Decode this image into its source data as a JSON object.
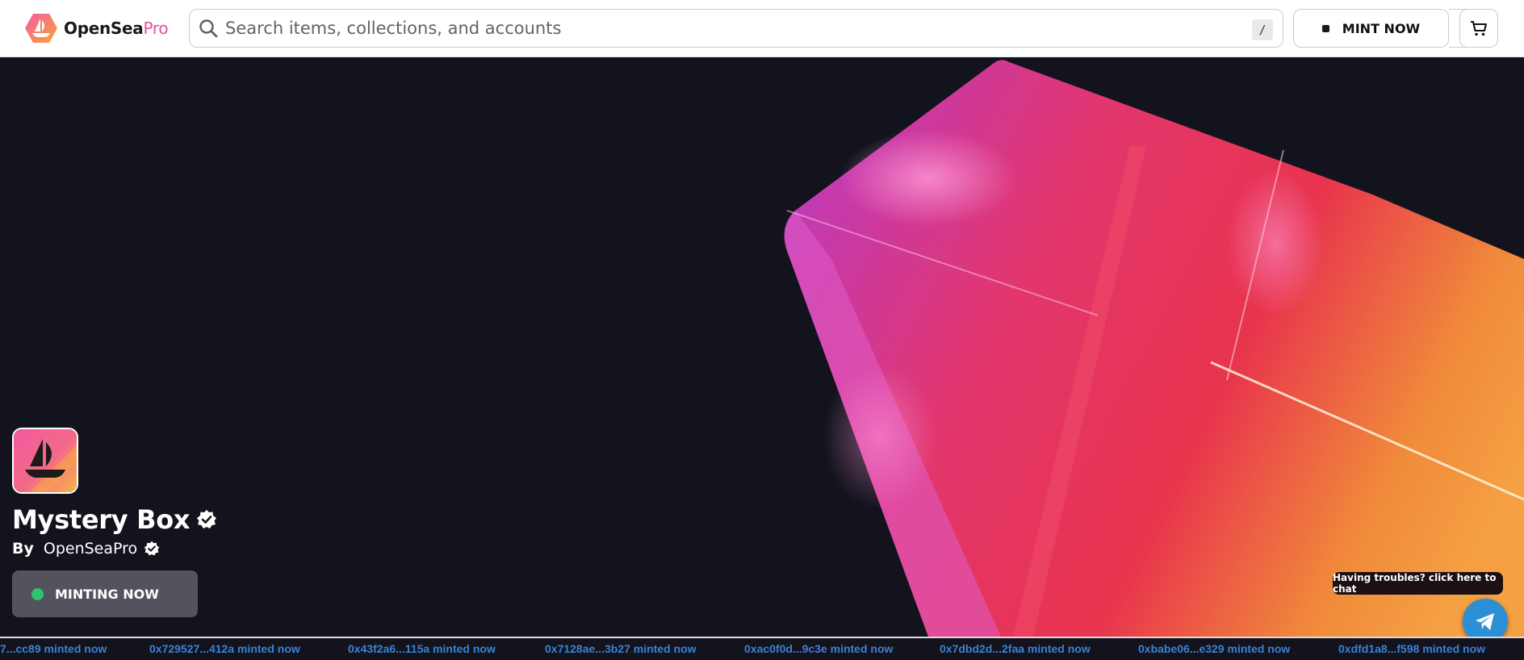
{
  "header": {
    "logo": {
      "brand": "OpenSea",
      "suffix": "Pro",
      "icon": "opensea-boat-icon"
    },
    "search": {
      "placeholder": "Search items, collections, and accounts",
      "shortcut_key": "/"
    },
    "mint_button": {
      "label": "MINT NOW"
    },
    "account_button": {
      "icon": "user-circle-icon"
    },
    "cart_button": {
      "icon": "cart-icon"
    }
  },
  "collection": {
    "name": "Mystery Box",
    "verified": true,
    "by_label": "By",
    "creator": "OpenSeaPro",
    "creator_verified": true,
    "status": "MINTING NOW",
    "status_color": "#2fc46b"
  },
  "chat": {
    "tooltip": "Having troubles? click here to chat",
    "icon": "telegram-icon",
    "color": "#2b8fd6"
  },
  "ticker": [
    {
      "text": "7...cc89 minted now"
    },
    {
      "text": "0x729527...412a minted now"
    },
    {
      "text": "0x43f2a6...115a minted now"
    },
    {
      "text": "0x7128ae...3b27 minted now"
    },
    {
      "text": "0xac0f0d...9c3e minted now"
    },
    {
      "text": "0x7dbd2d...2faa minted now"
    },
    {
      "text": "0xbabe06...e329 minted now"
    },
    {
      "text": "0xdfd1a8...f598 minted now"
    }
  ],
  "colors": {
    "accent": "#e2549c",
    "ticker_text": "#3a82d6",
    "hero_bg": "#13131d"
  }
}
